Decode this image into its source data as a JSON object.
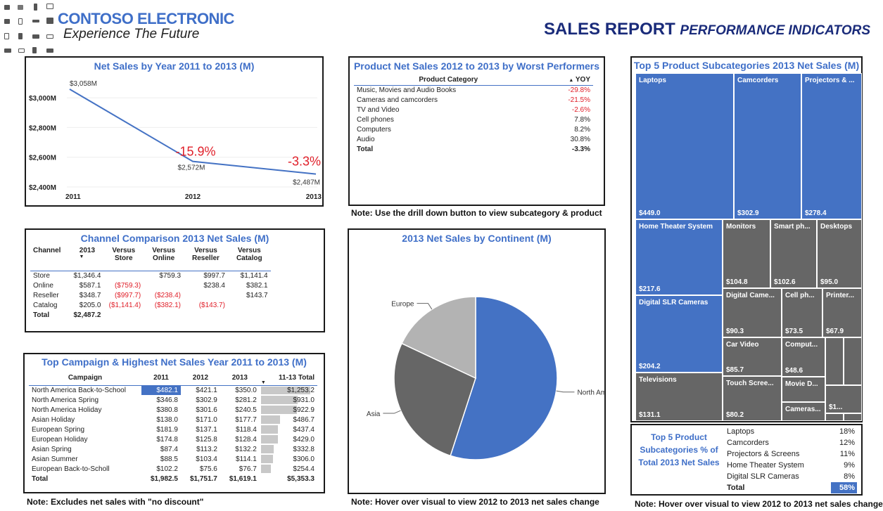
{
  "header": {
    "brand": "CONTOSO ELECTRONIC",
    "tagline": "Experience The Future",
    "title_main": "SALES REPORT",
    "title_sub": "PERFORMANCE INDICATORS"
  },
  "colors": {
    "accent": "#4472c4",
    "title": "#3f6fc8",
    "negative": "#e0202a",
    "dark": "#666666",
    "heading": "#1a2b7a"
  },
  "net_sales_panel": {
    "title": "Net Sales by Year 2011 to 2013 (M)",
    "y_ticks": [
      "$3,000M",
      "$2,800M",
      "$2,600M",
      "$2,400M"
    ],
    "point_labels": [
      "$3,058M",
      "$2,572M",
      "$2,487M"
    ],
    "change_labels": [
      "-15.9%",
      "-3.3%"
    ]
  },
  "worst_panel": {
    "title": "Product Net Sales 2012 to 2013 by Worst Performers",
    "col_category": "Product Category",
    "col_yoy": "YOY",
    "rows": [
      {
        "category": "Music, Movies and Audio Books",
        "yoy": "-29.8%",
        "neg": true
      },
      {
        "category": "Cameras and camcorders",
        "yoy": "-21.5%",
        "neg": true
      },
      {
        "category": "TV and Video",
        "yoy": "-2.6%",
        "neg": true
      },
      {
        "category": "Cell phones",
        "yoy": "7.8%",
        "neg": false
      },
      {
        "category": "Computers",
        "yoy": "8.2%",
        "neg": false
      },
      {
        "category": "Audio",
        "yoy": "30.8%",
        "neg": false
      }
    ],
    "total_label": "Total",
    "total_yoy": "-3.3%"
  },
  "notes": {
    "drill": "Note: Use the drill down button to view subcategory & product",
    "discount": "Note: Excludes net sales with \"no discount\"",
    "hover1": "Note: Hover over visual to view 2012 to 2013 net sales change",
    "hover2": "Note: Hover over visual to view 2012 to 2013 net sales change"
  },
  "channel_panel": {
    "title": "Channel Comparison 2013 Net Sales (M)",
    "headers": [
      "Channel",
      "2013",
      "Versus Store",
      "Versus Online",
      "Versus Reseller",
      "Versus Catalog"
    ],
    "rows": [
      {
        "c": [
          "Store",
          "$1,346.4",
          "",
          "$759.3",
          "$997.7",
          "$1,141.4"
        ],
        "neg": [
          false,
          false,
          false,
          false,
          false,
          false
        ]
      },
      {
        "c": [
          "Online",
          "$587.1",
          "($759.3)",
          "",
          "$238.4",
          "$382.1"
        ],
        "neg": [
          false,
          false,
          true,
          false,
          false,
          false
        ]
      },
      {
        "c": [
          "Reseller",
          "$348.7",
          "($997.7)",
          "($238.4)",
          "",
          "$143.7"
        ],
        "neg": [
          false,
          false,
          true,
          true,
          false,
          false
        ]
      },
      {
        "c": [
          "Catalog",
          "$205.0",
          "($1,141.4)",
          "($382.1)",
          "($143.7)",
          ""
        ],
        "neg": [
          false,
          false,
          true,
          true,
          true,
          false
        ]
      }
    ],
    "total": [
      "Total",
      "$2,487.2"
    ]
  },
  "campaign_panel": {
    "title": "Top Campaign & Highest Net Sales Year 2011 to 2013 (M)",
    "headers": [
      "Campaign",
      "2011",
      "2012",
      "2013",
      "11-13 Total"
    ],
    "rows": [
      [
        "North America Back-to-School",
        "$482.1",
        "$421.1",
        "$350.0",
        "$1,253.2"
      ],
      [
        "North America Spring",
        "$346.8",
        "$302.9",
        "$281.2",
        "$931.0"
      ],
      [
        "North America Holiday",
        "$380.8",
        "$301.6",
        "$240.5",
        "$922.9"
      ],
      [
        "Asian Holiday",
        "$138.0",
        "$171.0",
        "$177.7",
        "$486.7"
      ],
      [
        "European Spring",
        "$181.9",
        "$137.1",
        "$118.4",
        "$437.4"
      ],
      [
        "European Holiday",
        "$174.8",
        "$125.8",
        "$128.4",
        "$429.0"
      ],
      [
        "Asian Spring",
        "$87.4",
        "$113.2",
        "$132.2",
        "$332.8"
      ],
      [
        "Asian Summer",
        "$88.5",
        "$103.4",
        "$114.1",
        "$306.0"
      ],
      [
        "European Back-to-Scholl",
        "$102.2",
        "$75.6",
        "$76.7",
        "$254.4"
      ]
    ],
    "total": [
      "Total",
      "$1,982.5",
      "$1,751.7",
      "$1,619.1",
      "$5,353.3"
    ],
    "bar_fracs": [
      1.0,
      0.743,
      0.736,
      0.388,
      0.349,
      0.342,
      0.266,
      0.244,
      0.203
    ]
  },
  "continent_panel": {
    "title": "2013 Net Sales by Continent (M)"
  },
  "treemap_panel": {
    "title": "Top 5 Product Subcategories 2013 Net Sales (M)",
    "cells": [
      {
        "label": "Laptops",
        "value": "$449.0",
        "blue": true
      },
      {
        "label": "Camcorders",
        "value": "$302.9",
        "blue": true
      },
      {
        "label": "Projectors & ...",
        "value": "$278.4",
        "blue": true
      },
      {
        "label": "Home Theater System",
        "value": "$217.6",
        "blue": true
      },
      {
        "label": "Digital SLR Cameras",
        "value": "$204.2",
        "blue": true
      },
      {
        "label": "Televisions",
        "value": "$131.1",
        "blue": false
      },
      {
        "label": "Monitors",
        "value": "$104.8",
        "blue": false
      },
      {
        "label": "Smart ph...",
        "value": "$102.6",
        "blue": false
      },
      {
        "label": "Desktops",
        "value": "$95.0",
        "blue": false
      },
      {
        "label": "Digital Came...",
        "value": "$90.3",
        "blue": false
      },
      {
        "label": "Cell ph...",
        "value": "$73.5",
        "blue": false
      },
      {
        "label": "Printer...",
        "value": "$67.9",
        "blue": false
      },
      {
        "label": "Car Video",
        "value": "$85.7",
        "blue": false
      },
      {
        "label": "Comput...",
        "value": "$48.6",
        "blue": false
      },
      {
        "label": "Touch Scree...",
        "value": "$80.2",
        "blue": false
      },
      {
        "label": "Movie D...",
        "value": "",
        "blue": false
      },
      {
        "label": "Cameras...",
        "value": "",
        "blue": false
      },
      {
        "label": "",
        "value": "$1...",
        "blue": false
      }
    ]
  },
  "pct_panel": {
    "label": "Top 5 Product Subcategories % of Total 2013 Net Sales",
    "rows": [
      {
        "name": "Laptops",
        "pct": "18%"
      },
      {
        "name": "Camcorders",
        "pct": "12%"
      },
      {
        "name": "Projectors & Screens",
        "pct": "11%"
      },
      {
        "name": "Home Theater System",
        "pct": "9%"
      },
      {
        "name": "Digital SLR Cameras",
        "pct": "8%"
      }
    ],
    "total_label": "Total",
    "total_pct": "58%"
  },
  "chart_data": [
    {
      "type": "line",
      "title": "Net Sales by Year 2011 to 2013 (M)",
      "x": [
        "2011",
        "2012",
        "2013"
      ],
      "series": [
        {
          "values": [
            3058,
            2572,
            2487
          ]
        }
      ],
      "ylim": [
        2400,
        3100
      ],
      "y_ticks": [
        2400,
        2600,
        2800,
        3000
      ],
      "annotations": [
        "-15.9%",
        "-3.3%"
      ]
    },
    {
      "type": "pie",
      "title": "2013 Net Sales by Continent (M)",
      "labels": [
        "North America",
        "Asia",
        "Europe"
      ],
      "values": [
        55,
        27,
        18
      ],
      "colors": [
        "#4472c4",
        "#666666",
        "#b3b3b3"
      ]
    },
    {
      "type": "table",
      "title": "Top 5 Product Subcategories 2013 Net Sales (M)",
      "categories": [
        "Laptops",
        "Camcorders",
        "Projectors & ...",
        "Home Theater System",
        "Digital SLR Cameras",
        "Televisions",
        "Monitors",
        "Smart ph...",
        "Desktops",
        "Digital Came...",
        "Car Video",
        "Touch Scree...",
        "Cell ph...",
        "Printer...",
        "Comput..."
      ],
      "values": [
        449.0,
        302.9,
        278.4,
        217.6,
        204.2,
        131.1,
        104.8,
        102.6,
        95.0,
        90.3,
        85.7,
        80.2,
        73.5,
        67.9,
        48.6
      ]
    }
  ]
}
